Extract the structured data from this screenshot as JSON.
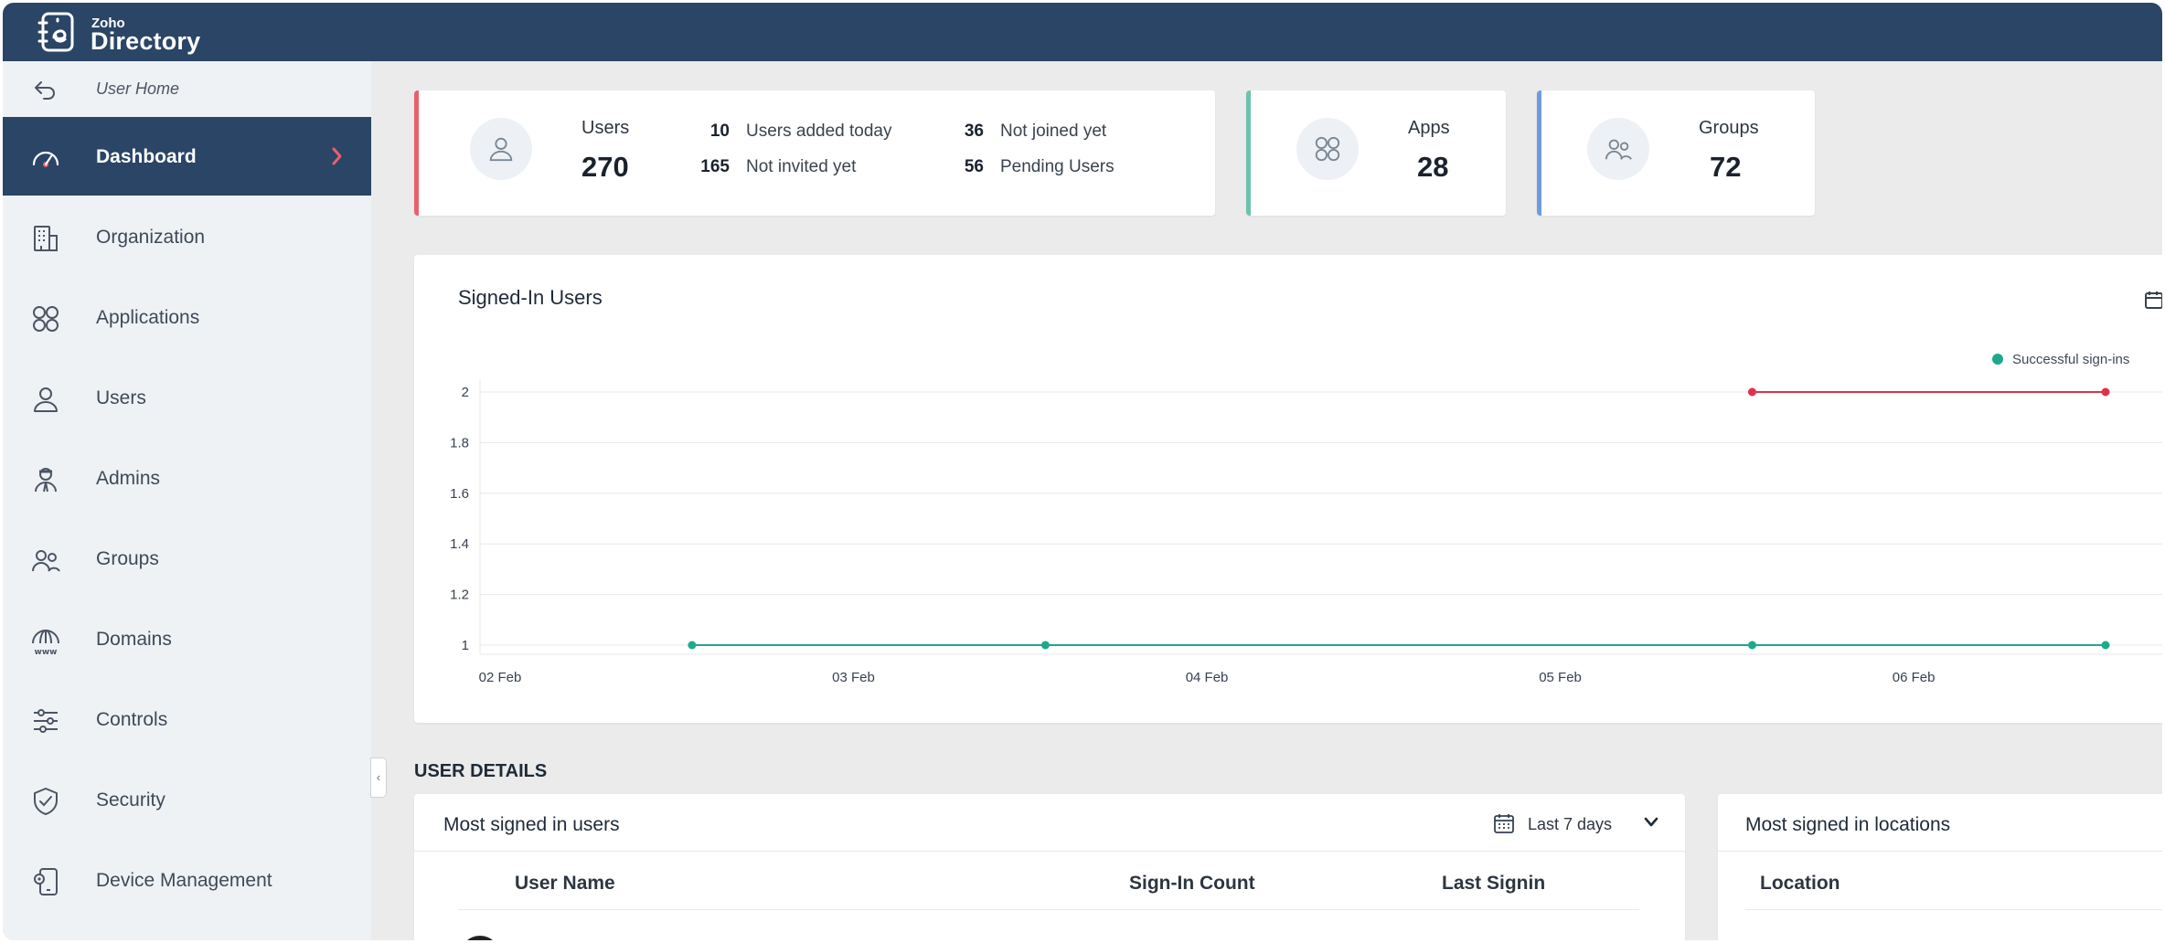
{
  "app": {
    "brand_top": "Zoho",
    "brand_main": "Directory"
  },
  "colors": {
    "header": "#2a4565",
    "users_accent": "#e8606e",
    "apps_accent": "#6cc3ae",
    "groups_accent": "#6f9be0",
    "series_green": "#1ea98a",
    "series_red": "#e0314c"
  },
  "sidebar": {
    "back_label": "User Home",
    "items": [
      {
        "label": "Dashboard",
        "icon": "dashboard-icon",
        "active": true
      },
      {
        "label": "Organization",
        "icon": "organization-icon"
      },
      {
        "label": "Applications",
        "icon": "applications-icon"
      },
      {
        "label": "Users",
        "icon": "user-icon"
      },
      {
        "label": "Admins",
        "icon": "admin-icon"
      },
      {
        "label": "Groups",
        "icon": "groups-icon"
      },
      {
        "label": "Domains",
        "icon": "domain-icon"
      },
      {
        "label": "Controls",
        "icon": "controls-icon"
      },
      {
        "label": "Security",
        "icon": "shield-icon"
      },
      {
        "label": "Device Management",
        "icon": "device-icon"
      }
    ],
    "collapse_glyph": "‹"
  },
  "stats": {
    "users": {
      "label": "Users",
      "value": "270",
      "details": [
        {
          "num": "10",
          "text": "Users added today"
        },
        {
          "num": "165",
          "text": "Not invited yet"
        },
        {
          "num": "36",
          "text": "Not joined yet"
        },
        {
          "num": "56",
          "text": "Pending Users"
        }
      ]
    },
    "apps": {
      "label": "Apps",
      "value": "28"
    },
    "groups": {
      "label": "Groups",
      "value": "72"
    }
  },
  "signed_in": {
    "title": "Signed-In Users",
    "legend": "Successful sign-ins"
  },
  "chart_data": {
    "type": "line",
    "title": "Signed-In Users",
    "xlabel": "",
    "ylabel": "",
    "x_ticks": [
      "02 Feb",
      "03 Feb",
      "04 Feb",
      "05 Feb",
      "06 Feb"
    ],
    "xlim": [
      0,
      4.6
    ],
    "ylim": [
      1,
      2
    ],
    "y_ticks": [
      "1",
      "1.2",
      "1.4",
      "1.6",
      "1.8",
      "2"
    ],
    "grid": true,
    "legend_position": "top-right",
    "series": [
      {
        "name": "Successful sign-ins",
        "color": "#1ea98a",
        "x": [
          0.6,
          1.6,
          3.6,
          4.6
        ],
        "y": [
          1,
          1,
          1,
          1
        ]
      },
      {
        "color": "#e0314c",
        "x": [
          3.6,
          4.6
        ],
        "y": [
          2,
          2
        ]
      }
    ]
  },
  "user_details": {
    "section_title": "USER DETAILS",
    "most_signed_users": {
      "title": "Most signed in users",
      "filter": "Last 7 days",
      "columns": [
        "User Name",
        "Sign-In Count",
        "Last Signin"
      ]
    },
    "most_signed_locations": {
      "title": "Most signed in locations",
      "columns": [
        "Location"
      ]
    }
  }
}
